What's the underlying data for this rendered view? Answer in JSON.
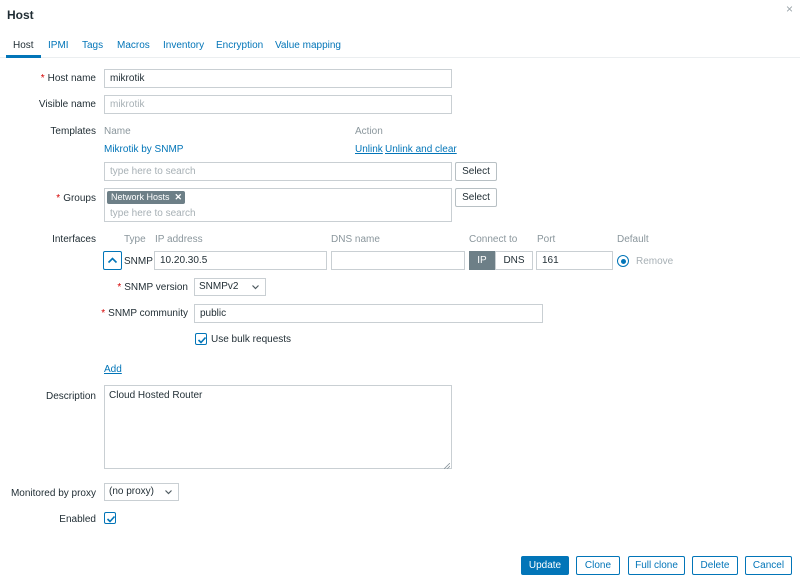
{
  "dialog": {
    "title": "Host",
    "close_glyph": "×"
  },
  "tabs": [
    {
      "label": "Host"
    },
    {
      "label": "IPMI"
    },
    {
      "label": "Tags"
    },
    {
      "label": "Macros"
    },
    {
      "label": "Inventory"
    },
    {
      "label": "Encryption"
    },
    {
      "label": "Value mapping"
    }
  ],
  "host_name": {
    "label": "Host name",
    "required_mark": "*",
    "value": "mikrotik"
  },
  "visible_name": {
    "label": "Visible name",
    "placeholder": "mikrotik"
  },
  "templates": {
    "label": "Templates",
    "col_name": "Name",
    "col_action": "Action",
    "items": [
      {
        "name": "Mikrotik by SNMP",
        "unlink": "Unlink",
        "unlink_clear": "Unlink and clear"
      }
    ],
    "search_placeholder": "type here to search",
    "select_label": "Select"
  },
  "groups": {
    "label": "Groups",
    "required_mark": "*",
    "tags": [
      {
        "label": "Network Hosts",
        "remove": "✕"
      }
    ],
    "search_placeholder": "type here to search",
    "select_label": "Select"
  },
  "interfaces": {
    "label": "Interfaces",
    "headers": {
      "type": "Type",
      "ip": "IP address",
      "dns": "DNS name",
      "connect": "Connect to",
      "port": "Port",
      "default": "Default"
    },
    "row": {
      "type": "SNMP",
      "ip": "10.20.30.5",
      "dns": "",
      "connect_ip": "IP",
      "connect_dns": "DNS",
      "port": "161",
      "remove": "Remove"
    },
    "snmp_version": {
      "label": "SNMP version",
      "required_mark": "*",
      "value": "SNMPv2"
    },
    "snmp_community": {
      "label": "SNMP community",
      "required_mark": "*",
      "value": "public"
    },
    "bulk": {
      "label": "Use bulk requests",
      "checked": true
    },
    "add_label": "Add"
  },
  "description": {
    "label": "Description",
    "value": "Cloud Hosted Router"
  },
  "proxy": {
    "label": "Monitored by proxy",
    "value": "(no proxy)"
  },
  "enabled": {
    "label": "Enabled",
    "checked": true
  },
  "footer": {
    "update": "Update",
    "clone": "Clone",
    "full_clone": "Full clone",
    "delete": "Delete",
    "cancel": "Cancel"
  },
  "colors": {
    "accent": "#0275b8",
    "required": "#d40000",
    "tag_bg": "#6d7f87"
  }
}
